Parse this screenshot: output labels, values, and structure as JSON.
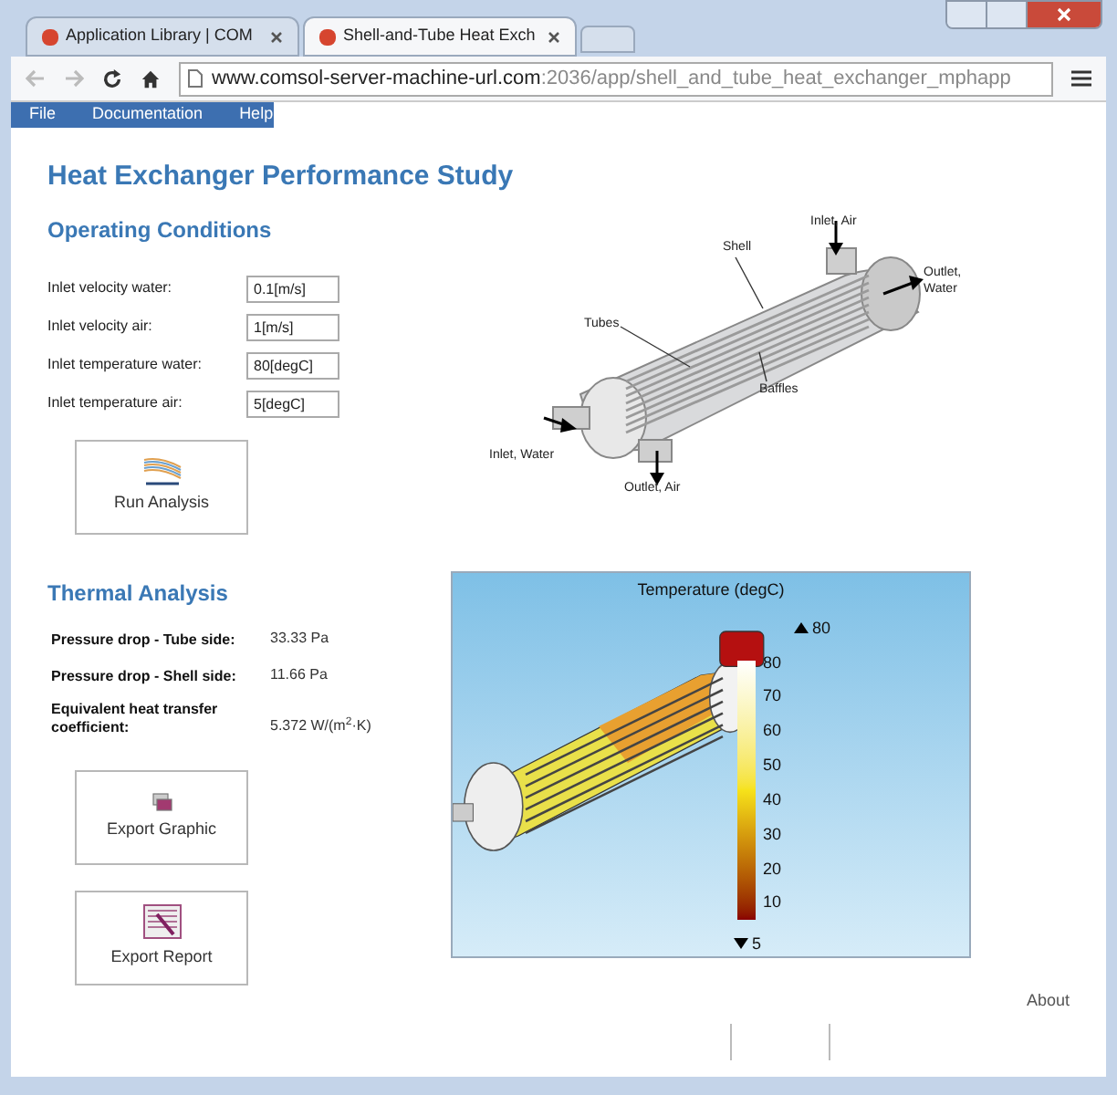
{
  "browser": {
    "tabs": [
      {
        "label": "Application Library | COM",
        "selected": false
      },
      {
        "label": "Shell-and-Tube Heat Exch",
        "selected": true
      }
    ],
    "url": {
      "host": "www.comsol-server-machine-url.com",
      "path": ":2036/app/shell_and_tube_heat_exchanger_mphapp"
    }
  },
  "menu": [
    "File",
    "Documentation",
    "Help"
  ],
  "title": "Heat Exchanger Performance Study",
  "operating": {
    "heading": "Operating Conditions",
    "fields": [
      {
        "label": "Inlet velocity water:",
        "value": "0.1[m/s]"
      },
      {
        "label": "Inlet velocity air:",
        "value": "1[m/s]"
      },
      {
        "label": "Inlet temperature water:",
        "value": "80[degC]"
      },
      {
        "label": "Inlet temperature air:",
        "value": "5[degC]"
      }
    ],
    "button": "Run Analysis"
  },
  "diagram": {
    "labels": [
      "Inlet, Air",
      "Shell",
      "Outlet, Water",
      "Tubes",
      "Baffles",
      "Inlet, Water",
      "Outlet, Air"
    ]
  },
  "thermal": {
    "heading": "Thermal Analysis",
    "results": [
      {
        "label": "Pressure drop - Tube side:",
        "value": "33.33 Pa"
      },
      {
        "label": "Pressure drop - Shell side:",
        "value": "11.66 Pa"
      },
      {
        "label": "Equivalent heat transfer coefficient:",
        "value": "5.372 W/(m$^{2}$·K)"
      }
    ],
    "buttons": [
      "Export Graphic",
      "Export Report"
    ]
  },
  "plot": {
    "title": "Temperature (degC)",
    "max_label": "80",
    "min_label": "5",
    "scale": [
      "80",
      "70",
      "60",
      "50",
      "40",
      "30",
      "20",
      "10"
    ]
  },
  "footer_link": "About"
}
